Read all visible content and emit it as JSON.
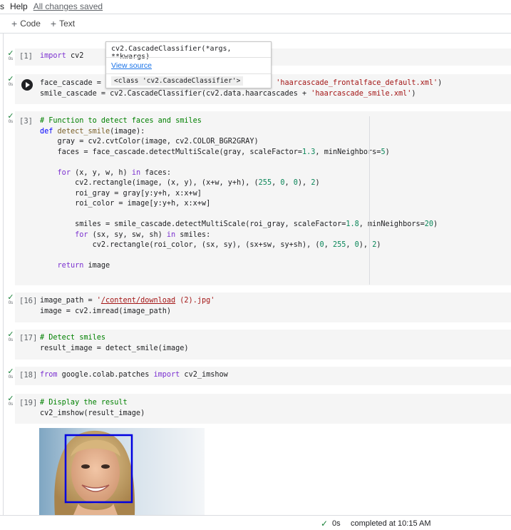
{
  "menu": {
    "items": [
      "s",
      "Help"
    ],
    "saved": "All changes saved"
  },
  "toolbar": {
    "code": "Code",
    "text": "Text"
  },
  "tooltip": {
    "signature": "cv2.CascadeClassifier(*args, **kwargs)",
    "view_source": "View source",
    "class_repr": "<class 'cv2.CascadeClassifier'>"
  },
  "cells": {
    "c1": {
      "count": "[1]",
      "time": "0s"
    },
    "c3": {
      "count": "[3]",
      "time": "0s"
    },
    "c16": {
      "count": "[16]",
      "time": "0s"
    },
    "c17": {
      "count": "[17]",
      "time": "0s"
    },
    "c18": {
      "count": "[18]",
      "time": "0s"
    },
    "c19": {
      "count": "[19]",
      "time": "0s"
    }
  },
  "status": {
    "time": "0s",
    "completed": "completed at 10:15 AM"
  },
  "colors": {
    "detection_box": "#0000e0",
    "check": "#188038"
  }
}
